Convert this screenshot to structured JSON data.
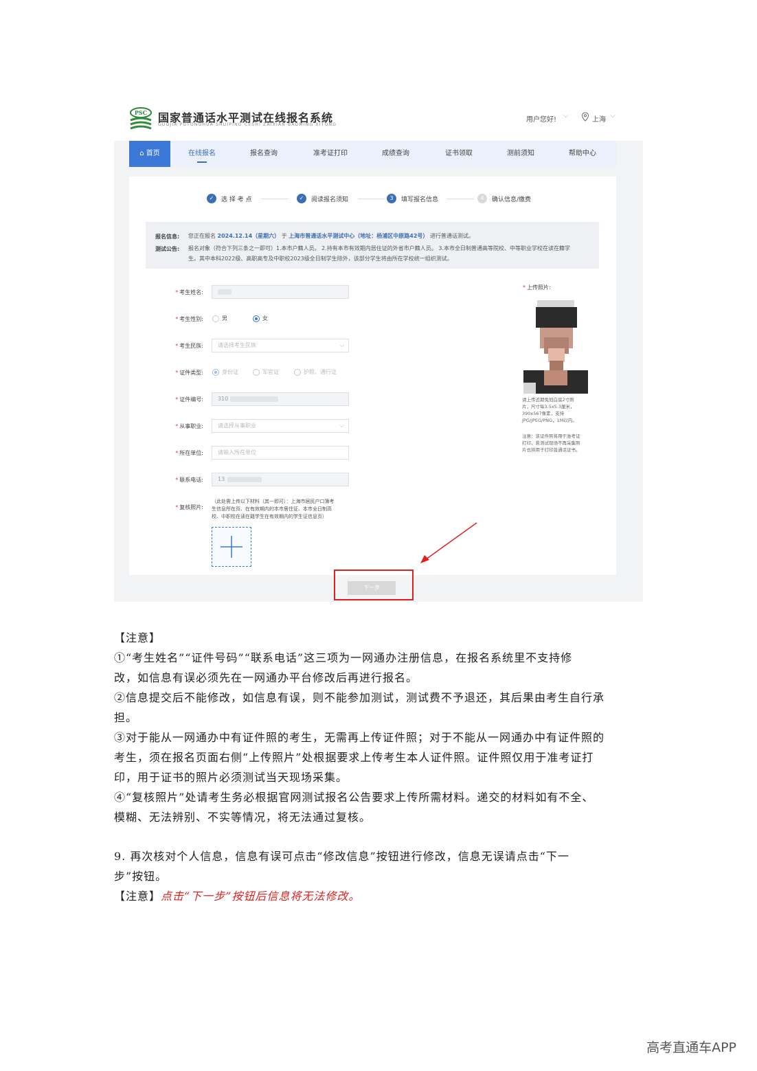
{
  "header": {
    "system_title": "国家普通话水平测试在线报名系统",
    "system_subtitle": "GUOJIA PUTONGHUA SHUIPING CESHI ZAIXIAN BAOMING XITONG",
    "logo_text": "PSC",
    "user_greeting": "用户您好!",
    "location": "上海"
  },
  "nav": {
    "items": [
      {
        "label": "首页"
      },
      {
        "label": "在线报名"
      },
      {
        "label": "报名查询"
      },
      {
        "label": "准考证打印"
      },
      {
        "label": "成绩查询"
      },
      {
        "label": "证书领取"
      },
      {
        "label": "测前须知"
      },
      {
        "label": "帮助中心"
      }
    ]
  },
  "steps": [
    {
      "num": "✓",
      "label": "选 择 考 点"
    },
    {
      "num": "✓",
      "label": "阅读报名须知"
    },
    {
      "num": "3",
      "label": "填写报名信息"
    },
    {
      "num": "4",
      "label": "确认信息/缴费"
    }
  ],
  "info": {
    "reg_key": "报名信息:",
    "reg_pre": "您正在报名",
    "reg_date": "2024.12.14（星期六）",
    "reg_mid": "于",
    "reg_center": "上海市普通话水平测试中心（地址：杨浦区中原路42号）",
    "reg_post": "进行普通话测试。",
    "notice_key": "测试公告:",
    "notice_line1": "报名对象（符合下列三条之一即可）1.本市户籍人员。 2.持有本市有效期内居住证的外省市户籍人员。 3.本市全日制普通高等院校、中等职业学校在读在籍学",
    "notice_line2": "生。其中本科2022级、高职高专及中职校2023级全日制学生除外，该部分学生将由所在学校统一组织测试。"
  },
  "form": {
    "name_label": "考生姓名:",
    "gender_label": "考生性别:",
    "gender_male": "男",
    "gender_female": "女",
    "ethnic_label": "考生民族:",
    "ethnic_placeholder": "请选择考生民族",
    "idtype_label": "证件类型:",
    "idtype_options": [
      "身份证",
      "军官证",
      "护照、通行证"
    ],
    "idno_label": "证件编号:",
    "idno_value": "310",
    "job_label": "从事职业:",
    "job_placeholder": "请选择从事职业",
    "unit_label": "所在单位:",
    "unit_placeholder": "请输入所在单位",
    "phone_label": "联系电话:",
    "phone_value": "13",
    "review_label": "复核照片:",
    "review_hint_1": "（此处需上传以下材料（其一即可）：上海市居民户口簿考",
    "review_hint_2": "生信息所在页、在有效期内的本市居住证、本市全日制高",
    "review_hint_3": "校、中职校在读在籍学生在有效期内的学生证信息页）"
  },
  "photo": {
    "label": "上传照片:",
    "desc_1": "请上传近期免冠白底2寸照",
    "desc_2": "片，尺寸每3.5x5.3厘米，",
    "desc_3": "390x567像素，支持",
    "desc_4": "JPG/JPEG/PNG，1M以内。",
    "note_1": "注意：该证件照将用于准考证",
    "note_2": "打印，若测试现场不再采集照",
    "note_3": "片也将用于打印普通话证书。"
  },
  "next_button": "下一步",
  "doc": {
    "notice_title": "【注意】",
    "p1a": "①“考生姓名”“证件号码”“联系电话”这三项为一网通办注册信息，在报名系统里不支持修",
    "p1b": "改，如信息有误必须先在一网通办平台修改后再进行报名。",
    "p2a": "②信息提交后不能修改，如信息有误，则不能参加测试，测试费不予退还，其后果由考生自行承",
    "p2b": "担。",
    "p3a": "③对于能从一网通办中有证件照的考生，无需再上传证件照；对于不能从一网通办中有证件照的",
    "p3b": "考生，须在报名页面右侧“上传照片”处根据要求上传考生本人证件照。证件照仅用于准考证打",
    "p3c": "印，用于证书的照片必须测试当天现场采集。",
    "p4a": "④“复核照片”处请考生务必根据官网测试报名公告要求上传所需材料。递交的材料如有不全、",
    "p4b": "模糊、无法辨别、不实等情况，将无法通过复核。",
    "s9a": "9. 再次核对个人信息，信息有误可点击“修改信息”按钮进行修改，信息无误请点击“下一",
    "s9b": "步”按钮。",
    "final_prefix": "【注意】",
    "final_red": "点击“下一步”按钮后信息将无法修改。"
  },
  "watermark": "高考直通车APP",
  "colors": {
    "primary": "#3b78d8",
    "nav_bg": "#eaf1fb",
    "highlight": "#e02020"
  }
}
